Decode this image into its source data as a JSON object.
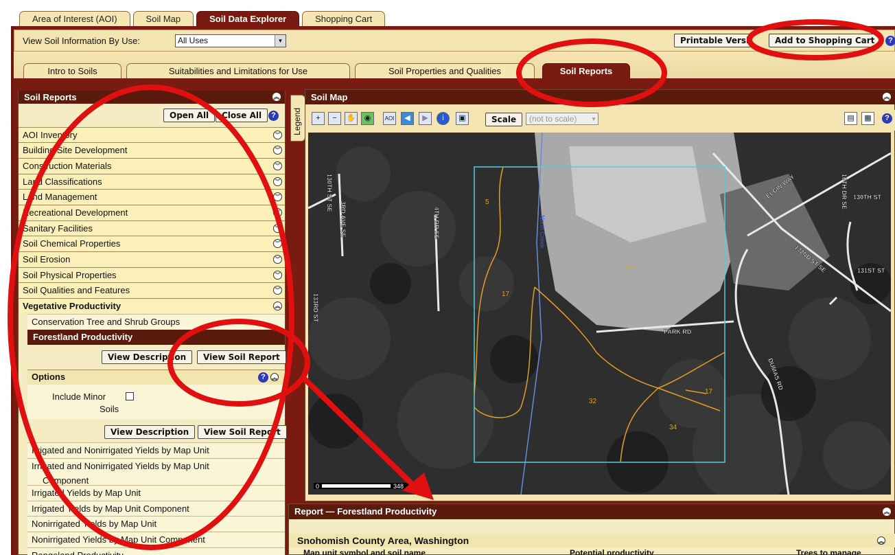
{
  "top_tabs": [
    {
      "label": "Area of Interest (AOI)",
      "active": false
    },
    {
      "label": "Soil Map",
      "active": false
    },
    {
      "label": "Soil Data Explorer",
      "active": true
    },
    {
      "label": "Shopping Cart",
      "active": false
    }
  ],
  "view_bar": {
    "label": "View Soil Information By Use:",
    "select_value": "All Uses",
    "printable": "Printable Versio",
    "add_to_cart": "Add to Shopping Cart"
  },
  "sub_tabs": [
    {
      "label": "Intro to Soils",
      "active": false
    },
    {
      "label": "Suitabilities and Limitations for Use",
      "active": false
    },
    {
      "label": "Soil Properties and Qualities",
      "active": false
    },
    {
      "label": "Soil Reports",
      "active": true
    }
  ],
  "soil_reports": {
    "title": "Soil Reports",
    "open_all": "Open All",
    "close_all": "Close All",
    "categories": [
      "AOI Inventory",
      "Building Site Development",
      "Construction Materials",
      "Land Classifications",
      "Land Management",
      "Recreational Development",
      "Sanitary Facilities",
      "Soil Chemical Properties",
      "Soil Erosion",
      "Soil Physical Properties",
      "Soil Qualities and Features",
      "Vegetative Productivity"
    ],
    "sub_first": "Conservation Tree and Shrub Groups",
    "selected_report": "Forestland Productivity",
    "view_description": "View Description",
    "view_soil_report": "View Soil Report",
    "options_title": "Options",
    "include_minor": "Include Minor",
    "soils": "Soils",
    "more_items": [
      "Irrigated and Nonirrigated Yields by Map Unit",
      "Irrigated and Nonirrigated Yields by Map Unit",
      "Component",
      "Irrigated Yields by Map Unit",
      "Irrigated Yields by Map Unit Component",
      "Nonirrigated Yields by Map Unit",
      "Nonirrigated Yields by Map Unit Component",
      "Rangeland Productivity"
    ]
  },
  "map": {
    "title": "Soil Map",
    "legend": "Legend",
    "scale_label": "Scale",
    "scale_value": "(not to scale)",
    "scalebar_start": "0",
    "scalebar_end": "348",
    "street_labels": [
      "130TH ST SE",
      "3RD AVE SE",
      "4TH DR SE",
      "133RD ST",
      "North Creek",
      "ELGIN WAY",
      "130TH ST",
      "10TH DR SE",
      "132ND ST SE",
      "131ST ST",
      "PARK RD",
      "DUMAS RD"
    ],
    "unit_labels": [
      "5",
      "17",
      "82",
      "32",
      "34",
      "17"
    ]
  },
  "report": {
    "title": "Report — Forestland Productivity",
    "county": "Snohomish County Area, Washington",
    "col1": "Map unit symbol and soil name",
    "col2": "Potential productivity",
    "col3": "Trees to manage"
  },
  "colors": {
    "maroon": "#7a1b12",
    "tan": "#f4e4b2",
    "annotation_red": "#e01010",
    "soil_line": "#e0a020",
    "aoi_box": "#4fd0d8"
  }
}
